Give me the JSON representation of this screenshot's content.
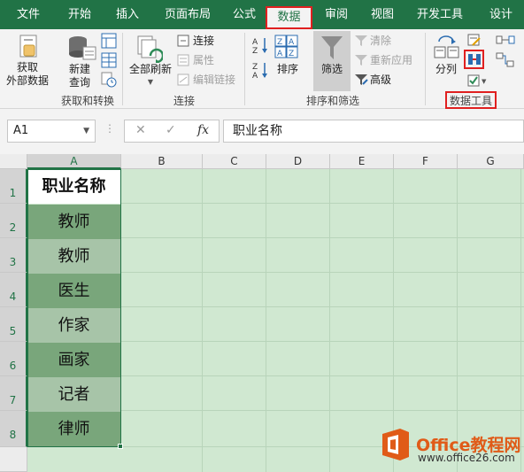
{
  "ribbon_tabs": [
    "文件",
    "开始",
    "插入",
    "页面布局",
    "公式",
    "数据",
    "审阅",
    "视图",
    "开发工具",
    "设计"
  ],
  "active_tab": "数据",
  "groups": {
    "get_transform": {
      "label": "获取和转换",
      "get_external_label": "获取\n外部数据",
      "new_query_label": "新建\n查询"
    },
    "connections": {
      "label": "连接",
      "refresh_all_label": "全部刷新",
      "connections_label": "连接",
      "properties_label": "属性",
      "edit_links_label": "编辑链接"
    },
    "sort_filter": {
      "label": "排序和筛选",
      "sort_label": "排序",
      "filter_label": "筛选",
      "clear_label": "清除",
      "reapply_label": "重新应用",
      "advanced_label": "高级"
    },
    "data_tools": {
      "label": "数据工具",
      "text_to_columns_label": "分列"
    }
  },
  "formula_bar": {
    "name_box": "A1",
    "formula": "职业名称",
    "fx": "fx"
  },
  "columns": [
    "A",
    "B",
    "C",
    "D",
    "E",
    "F",
    "G"
  ],
  "rows": [
    "1",
    "2",
    "3",
    "4",
    "5",
    "6",
    "7",
    "8"
  ],
  "cells_a": [
    "职业名称",
    "教师",
    "教师",
    "医生",
    "作家",
    "画家",
    "记者",
    "律师"
  ],
  "colors": {
    "excel_green": "#217346",
    "sheet_bg": "#d0e8d1",
    "cell_dark": "#79a67b",
    "cell_light": "#a7c4a8",
    "highlight_red": "#e02020",
    "watermark_orange": "#e05b18"
  },
  "watermark": {
    "title": "Office教程网",
    "url": "www.office26.com"
  }
}
